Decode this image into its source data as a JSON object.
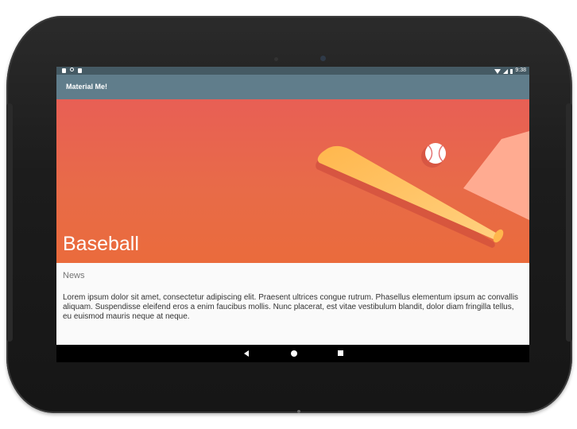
{
  "status_bar": {
    "left_icons": [
      "notification-square-icon",
      "sync-icon",
      "sd-card-icon"
    ],
    "right_icons": [
      "wifi-icon",
      "signal-icon",
      "battery-icon"
    ],
    "time": "9:38"
  },
  "app_bar": {
    "title": "Material Me!"
  },
  "card": {
    "title": "Baseball",
    "subtitle": "News",
    "body": "Lorem ipsum dolor sit amet, consectetur adipiscing elit. Praesent ultrices congue rutrum. Phasellus elementum ipsum ac convallis aliquam. Suspendisse eleifend eros a enim faucibus mollis. Nunc placerat, est vitae vestibulum blandit, dolor diam fringilla tellus, eu euismod mauris neque at neque."
  },
  "nav_bar": {
    "buttons": [
      "back-icon",
      "home-icon",
      "recents-icon"
    ]
  },
  "colors": {
    "status_bar": "#455a64",
    "app_bar": "#607d8b",
    "hero_top": "#e85f55",
    "hero_bottom": "#ea6b3c"
  }
}
